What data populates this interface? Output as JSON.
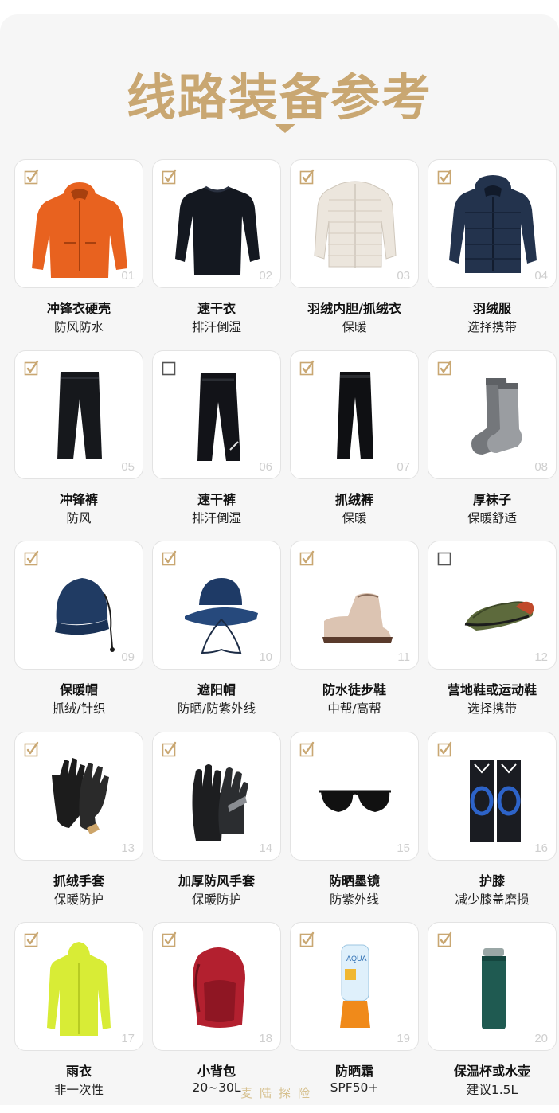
{
  "header": {
    "title": "线路装备参考"
  },
  "watermark": "麦陆探险",
  "colors": {
    "accent": "#c9a772",
    "card_border": "#e3e3e3",
    "background": "#f6f6f6"
  },
  "items": [
    {
      "num": "01",
      "name": "冲锋衣硬壳",
      "desc": "防风防水",
      "checked": true,
      "icon": "orange-hardshell-jacket-icon"
    },
    {
      "num": "02",
      "name": "速干衣",
      "desc": "排汗倒湿",
      "checked": true,
      "icon": "black-base-layer-icon"
    },
    {
      "num": "03",
      "name": "羽绒内胆/抓绒衣",
      "desc": "保暖",
      "checked": true,
      "icon": "white-light-down-jacket-icon"
    },
    {
      "num": "04",
      "name": "羽绒服",
      "desc": "选择携带",
      "checked": true,
      "icon": "navy-down-jacket-icon"
    },
    {
      "num": "05",
      "name": "冲锋裤",
      "desc": "防风",
      "checked": true,
      "icon": "black-hiking-pants-icon"
    },
    {
      "num": "06",
      "name": "速干裤",
      "desc": "排汗倒湿",
      "checked": false,
      "icon": "black-quickdry-pants-icon"
    },
    {
      "num": "07",
      "name": "抓绒裤",
      "desc": "保暖",
      "checked": true,
      "icon": "black-fleece-pants-icon"
    },
    {
      "num": "08",
      "name": "厚袜子",
      "desc": "保暖舒适",
      "checked": true,
      "icon": "grey-wool-socks-icon"
    },
    {
      "num": "09",
      "name": "保暖帽",
      "desc": "抓绒/针织",
      "checked": true,
      "icon": "navy-beanie-icon"
    },
    {
      "num": "10",
      "name": "遮阳帽",
      "desc": "防晒/防紫外线",
      "checked": true,
      "icon": "navy-bucket-hat-icon"
    },
    {
      "num": "11",
      "name": "防水徒步鞋",
      "desc": "中帮/高帮",
      "checked": true,
      "icon": "beige-hiking-boot-icon"
    },
    {
      "num": "12",
      "name": "营地鞋或运动鞋",
      "desc": "选择携带",
      "checked": false,
      "icon": "green-camp-shoes-icon"
    },
    {
      "num": "13",
      "name": "抓绒手套",
      "desc": "保暖防护",
      "checked": true,
      "icon": "black-fleece-gloves-icon"
    },
    {
      "num": "14",
      "name": "加厚防风手套",
      "desc": "保暖防护",
      "checked": true,
      "icon": "black-insulated-gloves-icon"
    },
    {
      "num": "15",
      "name": "防晒墨镜",
      "desc": "防紫外线",
      "checked": true,
      "icon": "sunglasses-icon"
    },
    {
      "num": "16",
      "name": "护膝",
      "desc": "减少膝盖磨损",
      "checked": true,
      "icon": "knee-brace-icon"
    },
    {
      "num": "17",
      "name": "雨衣",
      "desc": "非一次性",
      "checked": true,
      "icon": "yellow-raincoat-icon"
    },
    {
      "num": "18",
      "name": "小背包",
      "desc": "20~30L",
      "checked": true,
      "icon": "red-daypack-icon"
    },
    {
      "num": "19",
      "name": "防晒霜",
      "desc": "SPF50+",
      "checked": true,
      "icon": "sunscreen-bottle-icon"
    },
    {
      "num": "20",
      "name": "保温杯或水壶",
      "desc": "建议1.5L",
      "checked": true,
      "icon": "green-thermos-icon"
    }
  ]
}
